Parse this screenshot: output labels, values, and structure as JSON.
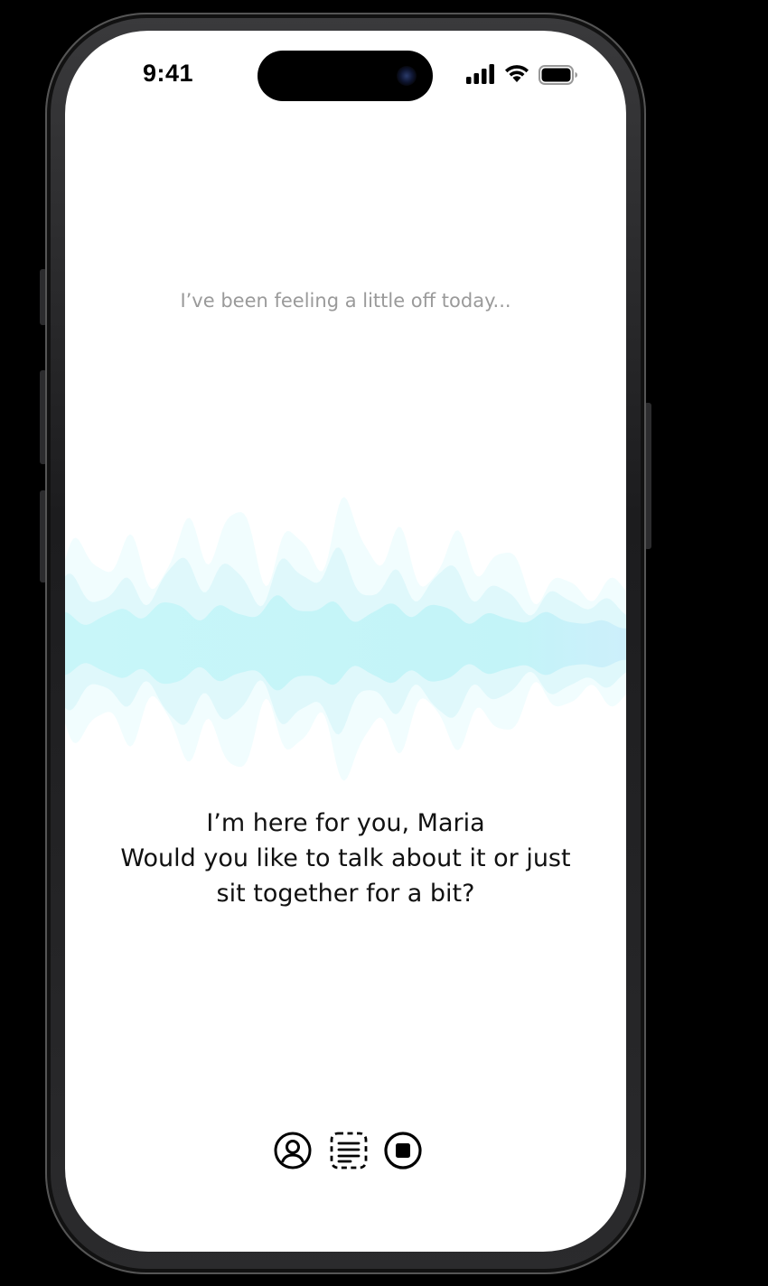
{
  "status_bar": {
    "time": "9:41",
    "icons": [
      "cellular-signal-icon",
      "wifi-icon",
      "battery-icon"
    ]
  },
  "conversation": {
    "user_message": "I’ve been feeling a little off today...",
    "assistant_reply": {
      "line1": "I’m here for you, Maria",
      "line2": "Would you like to talk about it or just",
      "line3": "sit together for a bit?"
    }
  },
  "controls": {
    "profile": {
      "icon": "user-circle-icon"
    },
    "transcript": {
      "icon": "transcript-icon"
    },
    "stop": {
      "icon": "stop-circle-icon"
    }
  },
  "colors": {
    "waveform_outer": "#F1FDFE",
    "waveform_mid": "#DDF8FB",
    "waveform_inner": "#C6F5F8",
    "user_text": "#9A9A9A",
    "reply_text": "#111111",
    "background": "#FFFFFF"
  }
}
